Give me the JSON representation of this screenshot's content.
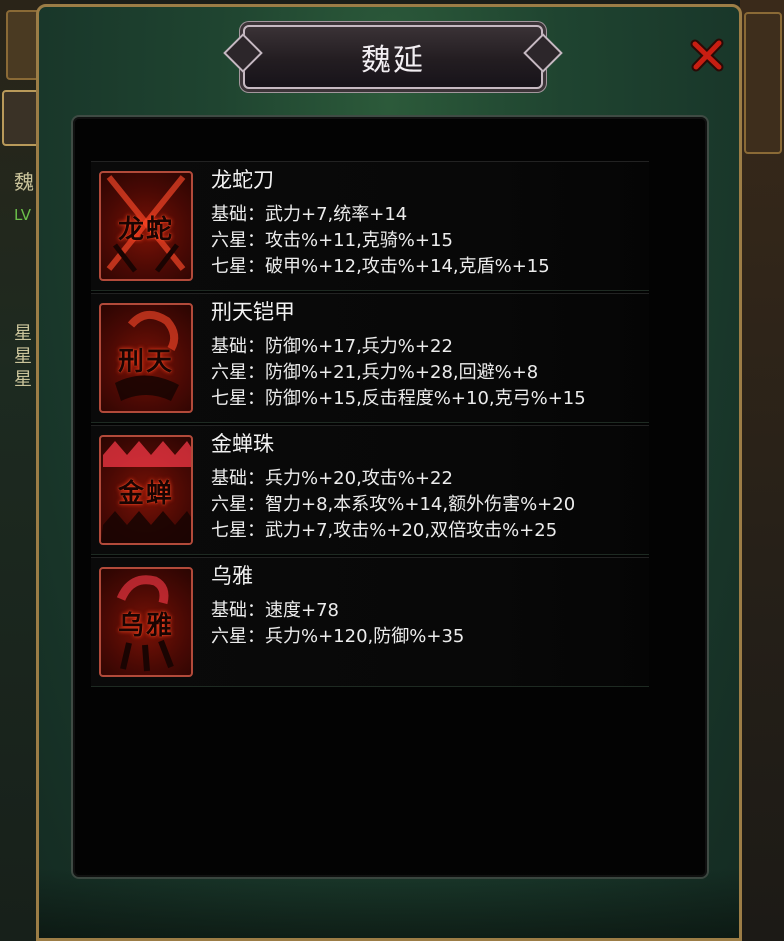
{
  "background": {
    "left_name_partial": "魏",
    "left_level_partial": "LV",
    "left_star_partial": "星星星"
  },
  "dialog": {
    "title": "魏延",
    "close_icon": "close-x-icon"
  },
  "items": [
    {
      "name": "龙蛇刀",
      "icon_glyph": "龙蛇",
      "icon": "crossed-blades-icon",
      "stats": [
        {
          "text": "基础：武力+7,统率+14"
        },
        {
          "text": "六星：攻击%+11,克骑%+15"
        },
        {
          "text": "七星：破甲%+12,攻击%+14,克盾%+15"
        }
      ]
    },
    {
      "name": "刑天铠甲",
      "icon_glyph": "刑天",
      "icon": "armor-helmet-icon",
      "stats": [
        {
          "text": "基础：防御%+17,兵力%+22"
        },
        {
          "text": "六星：防御%+21,兵力%+28,回避%+8"
        },
        {
          "text": "七星：防御%+15,反击程度%+10,克弓%+15"
        }
      ]
    },
    {
      "name": "金蝉珠",
      "icon_glyph": "金蝉",
      "icon": "diamond-pattern-icon",
      "stats": [
        {
          "text": "基础：兵力%+20,攻击%+22"
        },
        {
          "text": "六星：智力+8,本系攻%+14,额外伤害%+20"
        },
        {
          "text": "七星：武力+7,攻击%+20,双倍攻击%+25"
        }
      ]
    },
    {
      "name": "乌雅",
      "icon_glyph": "乌雅",
      "icon": "warhorse-icon",
      "stats": [
        {
          "text": "基础：速度+78"
        },
        {
          "text": "六星：兵力%+120,防御%+35"
        }
      ]
    }
  ]
}
